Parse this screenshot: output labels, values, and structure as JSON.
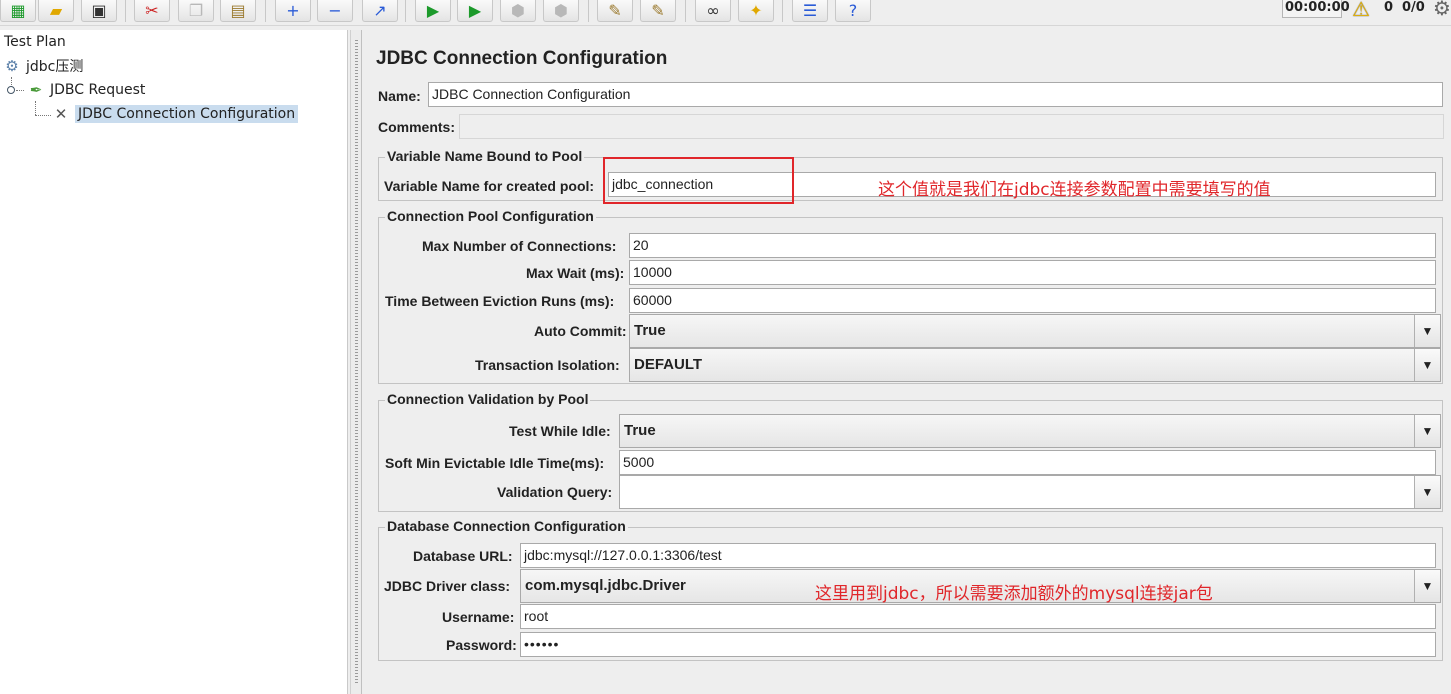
{
  "toolbar": {
    "icons": [
      "templates-icon",
      "open-icon",
      "save-icon",
      "cut-icon",
      "copy-icon",
      "paste-icon",
      "expand-icon",
      "collapse-icon",
      "toggle-icon",
      "start-icon",
      "start-no-pause-icon",
      "stop-icon",
      "shutdown-icon",
      "clear-icon",
      "clear-all-icon",
      "search-icon",
      "reset-search-icon",
      "function-helper-icon",
      "help-icon"
    ],
    "timer": "00:00:00",
    "warning_count": "0",
    "thread_count": "0/0"
  },
  "tree": {
    "root": "Test Plan",
    "thread_group": "jdbc压测",
    "sampler": "JDBC Request",
    "config": "JDBC Connection Configuration"
  },
  "panel": {
    "title": "JDBC Connection Configuration",
    "name_label": "Name:",
    "name_value": "JDBC Connection Configuration",
    "comments_label": "Comments:",
    "var_group": {
      "title": "Variable Name Bound to Pool",
      "var_label": "Variable Name for created pool:",
      "var_value": "jdbc_connection"
    },
    "pool_group": {
      "title": "Connection Pool Configuration",
      "max_conn_label": "Max Number of Connections:",
      "max_conn_value": "20",
      "max_wait_label": "Max Wait (ms):",
      "max_wait_value": "10000",
      "eviction_label": "Time Between Eviction Runs (ms):",
      "eviction_value": "60000",
      "auto_commit_label": "Auto Commit:",
      "auto_commit_value": "True",
      "isolation_label": "Transaction Isolation:",
      "isolation_value": "DEFAULT"
    },
    "validation_group": {
      "title": "Connection Validation by Pool",
      "test_idle_label": "Test While Idle:",
      "test_idle_value": "True",
      "soft_min_label": "Soft Min Evictable Idle Time(ms):",
      "soft_min_value": "5000",
      "query_label": "Validation Query:",
      "query_value": ""
    },
    "db_group": {
      "title": "Database Connection Configuration",
      "url_label": "Database URL:",
      "url_value": "jdbc:mysql://127.0.0.1:3306/test",
      "driver_label": "JDBC Driver class:",
      "driver_value": "com.mysql.jdbc.Driver",
      "user_label": "Username:",
      "user_value": "root",
      "pass_label": "Password:",
      "pass_value": "••••••"
    }
  },
  "annotations": {
    "var_note": "这个值就是我们在jdbc连接参数配置中需要填写的值",
    "driver_note": "这里用到jdbc，所以需要添加额外的mysql连接jar包"
  },
  "colors": {
    "annotation": "#e0262a",
    "selection": "#c9dcee"
  }
}
